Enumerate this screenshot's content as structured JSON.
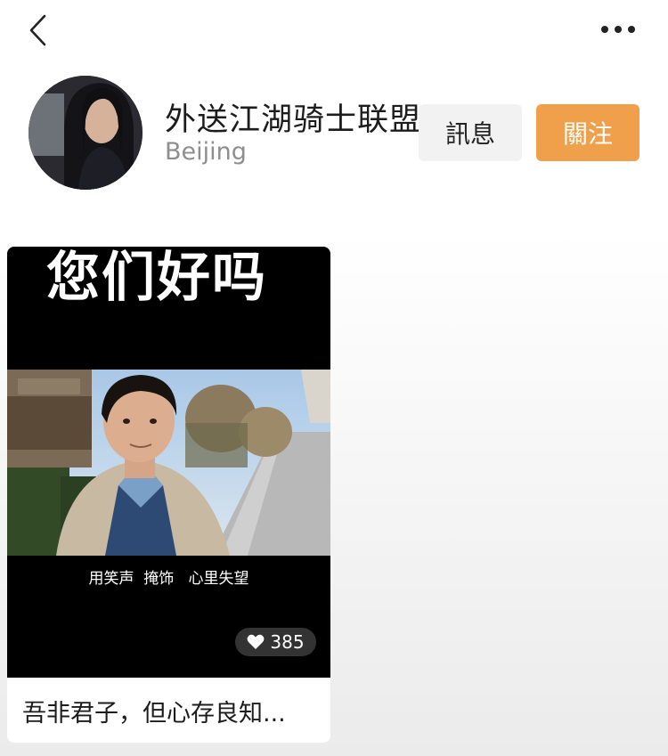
{
  "header": {
    "back_icon": "chevron-left-icon",
    "more_icon": "more-horizontal-icon"
  },
  "profile": {
    "username": "外送江湖骑士联盟",
    "location": "Beijing",
    "message_label": "訊息",
    "follow_label": "關注",
    "follow_color": "#f0a04b"
  },
  "videos": [
    {
      "overlay_title": "您们好吗",
      "caption": "用笑声  掩饰   心里失望",
      "likes": "385",
      "title": "吾非君子，但心存良知..."
    }
  ]
}
